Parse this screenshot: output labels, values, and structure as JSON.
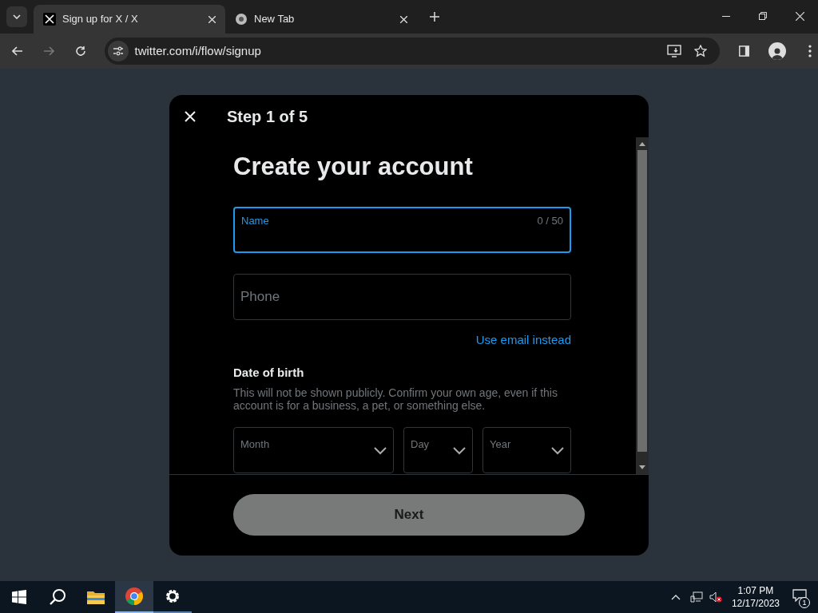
{
  "browser": {
    "tabs": [
      {
        "title": "Sign up for X / X",
        "kind": "x",
        "selected": true
      },
      {
        "title": "New Tab",
        "kind": "chrome",
        "selected": false
      }
    ],
    "url": "twitter.com/i/flow/signup"
  },
  "modal": {
    "step": "Step 1 of 5",
    "heading": "Create your account",
    "name_field": {
      "label": "Name",
      "counter": "0 / 50",
      "focused": true
    },
    "phone_field": {
      "placeholder": "Phone",
      "focused": false
    },
    "switch_link": "Use email instead",
    "dob": {
      "title": "Date of birth",
      "description": "This will not be shown publicly. Confirm your own age, even if this account is for a business, a pet, or something else.",
      "selects": [
        {
          "label": "Month"
        },
        {
          "label": "Day"
        },
        {
          "label": "Year"
        }
      ]
    },
    "next_button": {
      "label": "Next",
      "disabled": true
    }
  },
  "taskbar": {
    "apps": [
      {
        "kind": "start",
        "selected": false
      },
      {
        "kind": "search",
        "selected": false
      },
      {
        "kind": "files",
        "selected": false
      },
      {
        "kind": "chrome",
        "selected": true
      },
      {
        "kind": "settings",
        "selected": false
      }
    ],
    "time": "1:07 PM",
    "date": "12/17/2023",
    "notification_count": "1"
  }
}
